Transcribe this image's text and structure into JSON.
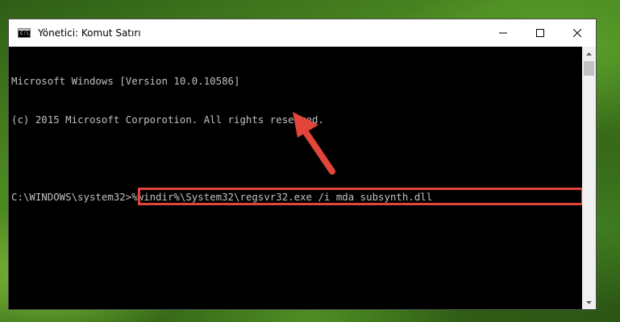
{
  "window": {
    "title": "Yönetici: Komut Satırı",
    "icon": "cmd-icon",
    "icon_text": "C:\\",
    "controls": {
      "minimize": "minimize-icon",
      "maximize": "maximize-icon",
      "close": "close-icon"
    }
  },
  "console": {
    "lines": [
      "Microsoft Windows [Version 10.0.10586]",
      "(c) 2015 Microsoft Corporotion. All rights reserved.",
      ""
    ],
    "prompt": "C:\\WINDOWS\\system32>",
    "command": "%windir%\\System32\\regsvr32.exe /i mda subsynth.dll"
  },
  "annotation": {
    "color": "#e2453a",
    "type": "arrow-pointing-to-command"
  }
}
